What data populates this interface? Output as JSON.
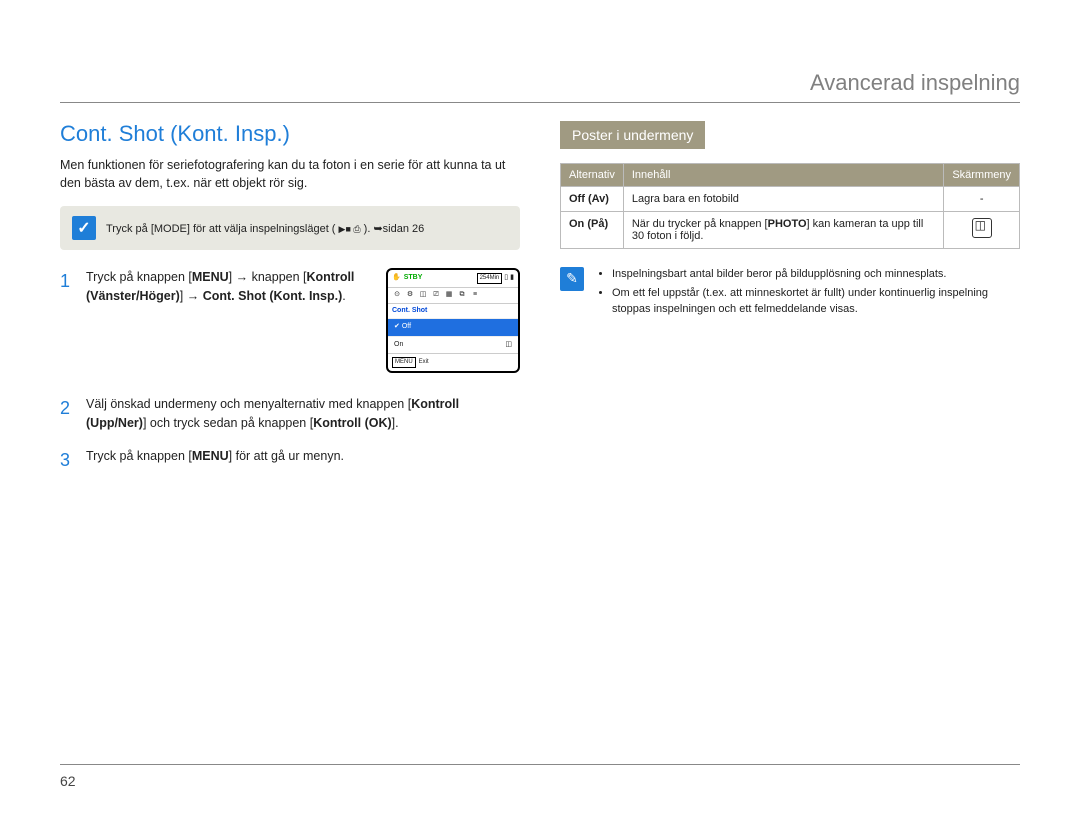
{
  "header": {
    "breadcrumb": "Avancerad inspelning"
  },
  "left": {
    "title": "Cont. Shot (Kont. Insp.)",
    "intro": "Men funktionen för seriefotografering kan du ta foton i en serie för att kunna ta ut den bästa av dem, t.ex. när ett objekt rör sig.",
    "note": {
      "pre": "Tryck på [",
      "mode": "MODE",
      "mid": "] för att välja inspelningsläget ( ",
      "icons": "▶■ ⎙",
      "post": " ). ",
      "pageref": "➥sidan 26"
    },
    "steps": [
      {
        "num": "1",
        "t1": "Tryck på knappen [",
        "b1": "MENU",
        "t2": "] ",
        "arrow1": "→",
        "t3": " knappen [",
        "b2": "Kontroll (Vänster/Höger)",
        "t4": "] ",
        "arrow2": "→",
        "t5": " ",
        "b3": "Cont. Shot (Kont. Insp.)",
        "t6": "."
      },
      {
        "num": "2",
        "t1": "Välj önskad undermeny och menyalternativ med knappen [",
        "b1": "Kontroll (Upp/Ner)",
        "t2": "] och tryck sedan på knappen [",
        "b2": "Kontroll (OK)",
        "t3": "]."
      },
      {
        "num": "3",
        "t1": "Tryck på knappen [",
        "b1": "MENU",
        "t2": "] för att gå ur menyn."
      }
    ],
    "lcd": {
      "stby": "STBY",
      "time_box": "254Min",
      "menu_title": "Cont. Shot",
      "row_off": "Off",
      "row_on": "On",
      "exit_label": "Exit",
      "menu_tag": "MENU"
    }
  },
  "right": {
    "subtitle": "Poster i undermeny",
    "table": {
      "headers": {
        "alt": "Alternativ",
        "content": "Innehåll",
        "screen": "Skärmmeny"
      },
      "rows": [
        {
          "opt": "Off (Av)",
          "desc": "Lagra bara en fotobild",
          "screen": "-"
        },
        {
          "opt": "On (På)",
          "desc_pre": "När du trycker på knappen [",
          "desc_bold": "PHOTO",
          "desc_post": "] kan kameran ta upp till 30 foton i följd.",
          "screen_icon": true
        }
      ]
    },
    "info": {
      "items": [
        "Inspelningsbart antal bilder beror på bildupplösning och minnesplats.",
        "Om ett fel uppstår (t.ex. att minneskortet är fullt) under kontinuerlig inspelning stoppas inspelningen och ett felmeddelande visas."
      ]
    }
  },
  "page_number": "62"
}
